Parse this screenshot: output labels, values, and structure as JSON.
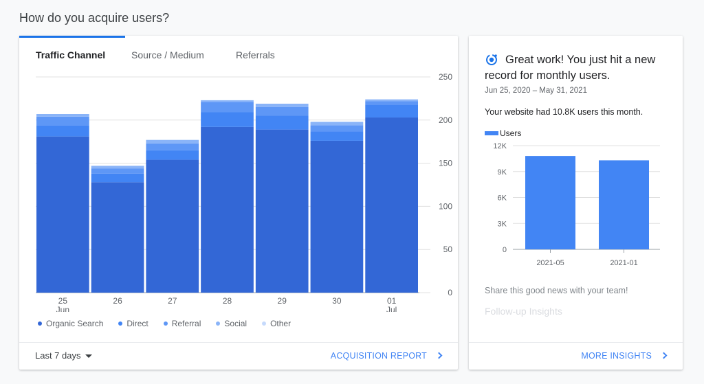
{
  "page_title": "How do you acquire users?",
  "tabs": [
    {
      "label": "Traffic Channel",
      "active": true
    },
    {
      "label": "Source / Medium",
      "active": false
    },
    {
      "label": "Referrals",
      "active": false
    }
  ],
  "colors": {
    "accent": "#1a73e8",
    "organic_search": "#3367d6",
    "direct": "#4285f4",
    "referral": "#5e97f6",
    "social": "#8ab4f8",
    "other": "#c6dafc",
    "link": "#4285f4"
  },
  "chart_data": [
    {
      "type": "bar",
      "stacked": true,
      "categories": [
        "25 Jun",
        "26",
        "27",
        "28",
        "29",
        "30",
        "01 Jul"
      ],
      "x_tick_labels": [
        {
          "top": "25",
          "bottom": "Jun"
        },
        {
          "top": "26",
          "bottom": ""
        },
        {
          "top": "27",
          "bottom": ""
        },
        {
          "top": "28",
          "bottom": ""
        },
        {
          "top": "29",
          "bottom": ""
        },
        {
          "top": "30",
          "bottom": ""
        },
        {
          "top": "01",
          "bottom": "Jul"
        }
      ],
      "series": [
        {
          "name": "Organic Search",
          "values": [
            181,
            128,
            154,
            192,
            189,
            176,
            203
          ]
        },
        {
          "name": "Direct",
          "values": [
            13,
            10,
            11,
            17,
            16,
            11,
            15
          ]
        },
        {
          "name": "Referral",
          "values": [
            10,
            6,
            8,
            12,
            10,
            7,
            4
          ]
        },
        {
          "name": "Social",
          "values": [
            3,
            3,
            4,
            2,
            4,
            4,
            2
          ]
        },
        {
          "name": "Other",
          "values": [
            0,
            0,
            0,
            0,
            0,
            0,
            0
          ]
        }
      ],
      "y_ticks": [
        0,
        50,
        100,
        150,
        200,
        250
      ],
      "ylim": [
        0,
        250
      ],
      "grid": true,
      "legend_position": "bottom-left",
      "ylabel_position": "right"
    },
    {
      "type": "bar",
      "categories": [
        "2021-05",
        "2021-01"
      ],
      "series": [
        {
          "name": "Users",
          "values": [
            10800,
            10300
          ]
        }
      ],
      "y_ticks": [
        "0",
        "3K",
        "6K",
        "9K",
        "12K"
      ],
      "y_tick_values": [
        0,
        3000,
        6000,
        9000,
        12000
      ],
      "ylim": [
        0,
        12000
      ],
      "grid": true,
      "legend_position": "top-left"
    }
  ],
  "left_footer": {
    "date_range": "Last 7 days",
    "link": "ACQUISITION REPORT"
  },
  "insight": {
    "icon": "insights-icon",
    "title": "Great work! You just hit a new record for monthly users.",
    "date_range": "Jun 25, 2020 – May 31, 2021",
    "description": "Your website had 10.8K users this month.",
    "legend_label": "Users",
    "share_text": "Share this good news with your team!",
    "followup": "Follow-up Insights",
    "link": "MORE INSIGHTS"
  }
}
